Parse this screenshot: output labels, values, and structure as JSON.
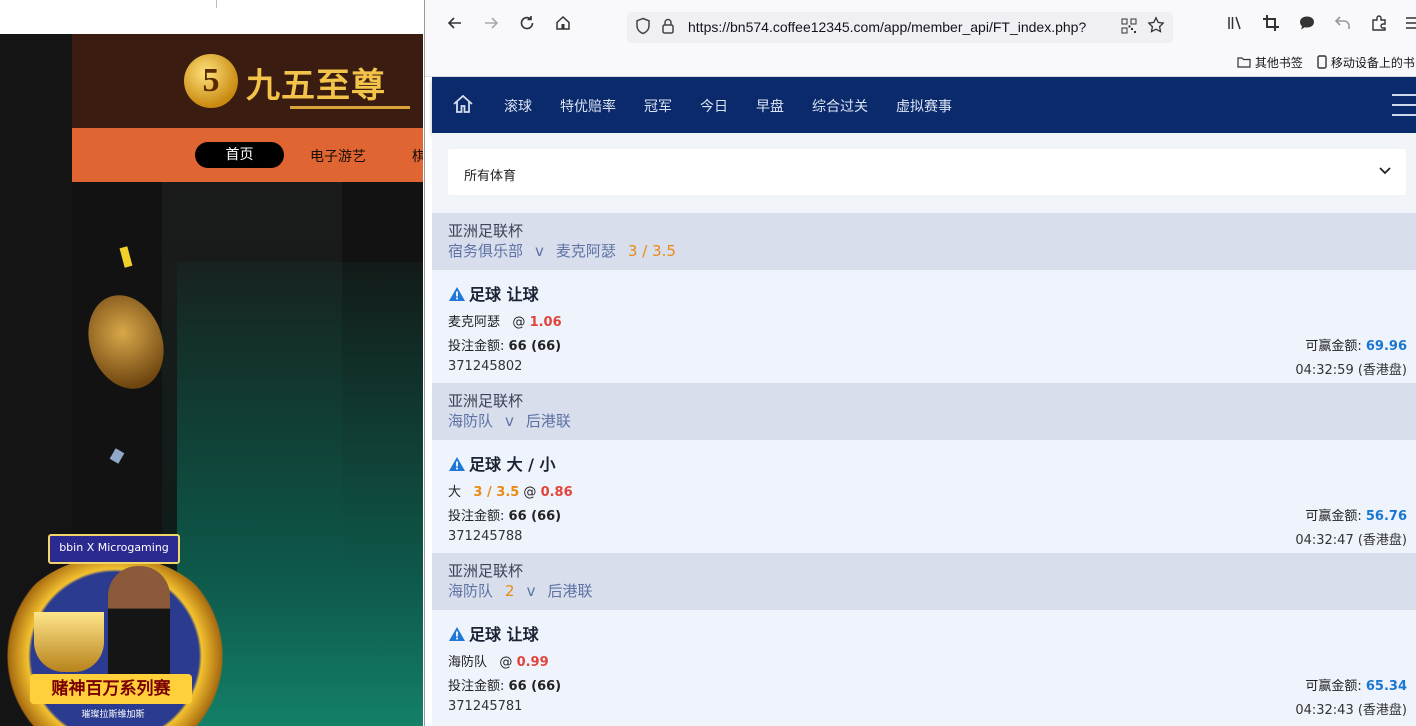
{
  "left_site": {
    "logo_badge": "5",
    "logo_text": "九五至尊",
    "nav": [
      "首页",
      "电子游艺",
      "棋"
    ],
    "promo": {
      "tag": "bbin X Microgaming",
      "title": "赌神百万系列赛",
      "subtitle": "璀璨拉斯维加斯"
    }
  },
  "browser": {
    "url": "https://bn574.coffee12345.com/app/member_api/FT_index.php?",
    "bookmarks": [
      "其他书签",
      "移动设备上的书"
    ],
    "icons": [
      "back-icon",
      "forward-icon",
      "reload-icon",
      "home-icon",
      "shield-icon",
      "lock-icon",
      "qr-code-icon",
      "bookmark-star-icon",
      "library-icon",
      "crop-icon",
      "chat-icon",
      "undo-icon",
      "extensions-icon",
      "menu-icon"
    ]
  },
  "app": {
    "nav": [
      "滚球",
      "特优赔率",
      "冠军",
      "今日",
      "早盘",
      "综合过关",
      "虚拟赛事"
    ],
    "sport_select": "所有体育",
    "bets": [
      {
        "league": "亚洲足联杯",
        "home": "宿务俱乐部",
        "vs": "v",
        "away": "麦克阿瑟",
        "header_handicap": "3 / 3.5",
        "title": "足球 让球",
        "selection": "麦克阿瑟",
        "sel_handicap": "",
        "odds": "1.06",
        "stake_label": "投注金额:",
        "stake": "66 (66)",
        "win_label": "可赢金额:",
        "win": "69.96",
        "ticket": "371245802",
        "time": "04:32:59 (香港盘)"
      },
      {
        "league": "亚洲足联杯",
        "home": "海防队",
        "vs": "v",
        "away": "后港联",
        "header_handicap": "",
        "title": "足球 大 / 小",
        "selection": "大",
        "sel_handicap": "3 / 3.5",
        "odds": "0.86",
        "stake_label": "投注金额:",
        "stake": "66 (66)",
        "win_label": "可赢金额:",
        "win": "56.76",
        "ticket": "371245788",
        "time": "04:32:47 (香港盘)"
      },
      {
        "league": "亚洲足联杯",
        "home": "海防队",
        "vs": "v",
        "away": "后港联",
        "header_handicap": "2",
        "title": "足球 让球",
        "selection": "海防队",
        "sel_handicap": "",
        "odds": "0.99",
        "stake_label": "投注金额:",
        "stake": "66 (66)",
        "win_label": "可赢金额:",
        "win": "65.34",
        "ticket": "371245781",
        "time": "04:32:43 (香港盘)"
      }
    ]
  },
  "colors": {
    "app_nav_bg": "#0a2a6b",
    "odds_red": "#e0443a",
    "handicap_orange": "#e98a12",
    "win_blue": "#1976d2",
    "site_nav_orange": "#df6632"
  }
}
